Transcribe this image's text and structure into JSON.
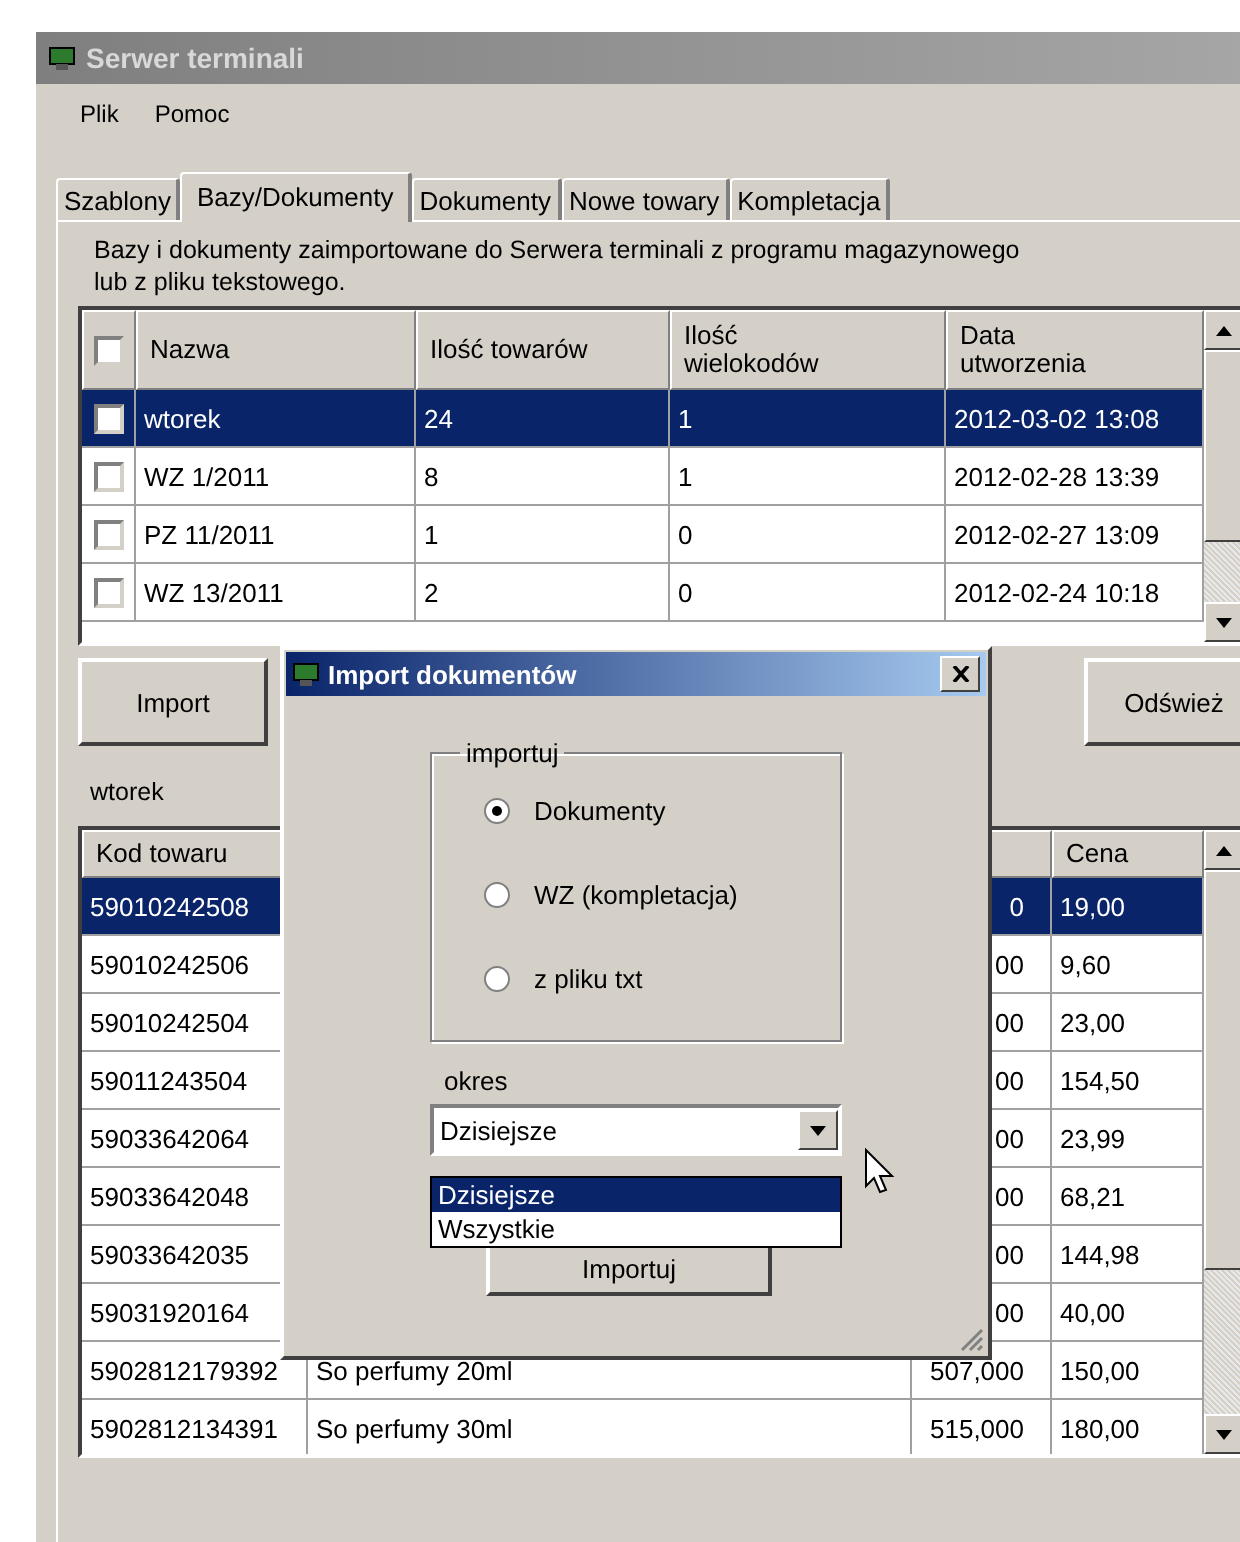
{
  "window": {
    "title": "Serwer terminali"
  },
  "menu": [
    {
      "label": "Plik"
    },
    {
      "label": "Pomoc"
    }
  ],
  "tabs": [
    {
      "label": "Szablony",
      "selected": false
    },
    {
      "label": "Bazy/Dokumenty",
      "selected": true
    },
    {
      "label": "Dokumenty",
      "selected": false
    },
    {
      "label": "Nowe towary",
      "selected": false
    },
    {
      "label": "Kompletacja",
      "selected": false
    }
  ],
  "description": "Bazy i dokumenty zaimportowane do Serwera terminali z programu magazynowego\nlub z pliku tekstowego.",
  "documents": {
    "all_checked": false,
    "columns": [
      {
        "label": "Nazwa"
      },
      {
        "label": "Ilość towarów"
      },
      {
        "label": "Ilość\nwielokodów"
      },
      {
        "label": "Data\nutworzenia"
      }
    ],
    "rows": [
      {
        "checked": false,
        "selected": true,
        "cells": [
          "wtorek",
          "24",
          "1",
          "2012-03-02 13:08"
        ]
      },
      {
        "checked": false,
        "selected": false,
        "cells": [
          "WZ 1/2011",
          "8",
          "1",
          "2012-02-28 13:39"
        ]
      },
      {
        "checked": false,
        "selected": false,
        "cells": [
          "PZ 11/2011",
          "1",
          "0",
          "2012-02-27 13:09"
        ]
      },
      {
        "checked": false,
        "selected": false,
        "cells": [
          "WZ 13/2011",
          "2",
          "0",
          "2012-02-24 10:18"
        ]
      }
    ]
  },
  "buttons": [
    {
      "label": "Import"
    },
    {
      "label": "Odśwież"
    }
  ],
  "current_document": "wtorek",
  "items": {
    "code_header": "Kod towaru",
    "price_header": "Cena",
    "rows": [
      {
        "selected": true,
        "code": "59010242508",
        "qty": "0",
        "price": "19,00"
      },
      {
        "selected": false,
        "code": "59010242506",
        "qty": "00",
        "price": "9,60"
      },
      {
        "selected": false,
        "code": "59010242504",
        "qty": "00",
        "price": "23,00"
      },
      {
        "selected": false,
        "code": "59011243504",
        "qty": "00",
        "price": "154,50"
      },
      {
        "selected": false,
        "code": "59033642064",
        "qty": "00",
        "price": "23,99"
      },
      {
        "selected": false,
        "code": "59033642048",
        "qty": "00",
        "price": "68,21"
      },
      {
        "selected": false,
        "code": "59033642035",
        "qty": "00",
        "price": "144,98"
      },
      {
        "selected": false,
        "code": "59031920164",
        "qty": "00",
        "price": "40,00"
      },
      {
        "selected": false,
        "code": "5902812179392",
        "name": "So perfumy 20ml",
        "qty": "507,000",
        "price": "150,00"
      },
      {
        "selected": false,
        "code": "5902812134391",
        "name": "So perfumy 30ml",
        "qty": "515,000",
        "price": "180,00"
      }
    ]
  },
  "dialog": {
    "title": "Import dokumentów",
    "group_label": "importuj",
    "options": [
      {
        "label": "Dokumenty",
        "selected": true
      },
      {
        "label": "WZ (kompletacja)",
        "selected": false
      },
      {
        "label": "z pliku txt",
        "selected": false
      }
    ],
    "period_label": "okres",
    "period_value": "Dzisiejsze",
    "period_options": [
      {
        "label": "Dzisiejsze",
        "selected": true
      },
      {
        "label": "Wszystkie",
        "selected": false
      }
    ],
    "button": "Importuj"
  }
}
